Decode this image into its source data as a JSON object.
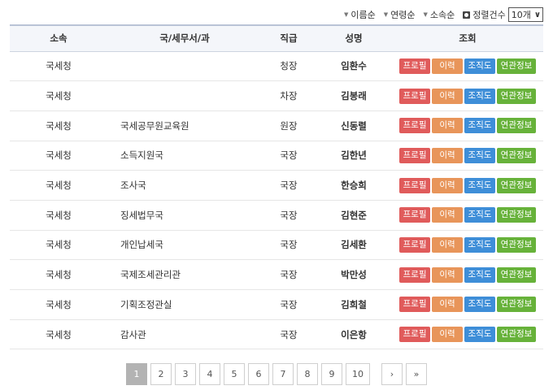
{
  "toolbar": {
    "sort_options": [
      {
        "label": "이름순"
      },
      {
        "label": "연령순"
      },
      {
        "label": "소속순"
      },
      {
        "label": "정렬건수"
      }
    ],
    "page_size": "10개"
  },
  "table": {
    "headers": [
      "소속",
      "국/세무서/과",
      "직급",
      "성명",
      "조회"
    ],
    "action_labels": {
      "profile": "프로필",
      "history": "이력",
      "org": "조직도",
      "related": "연관정보"
    },
    "rows": [
      {
        "org": "국세청",
        "dept": "",
        "rank": "청장",
        "name": "임환수"
      },
      {
        "org": "국세청",
        "dept": "",
        "rank": "차장",
        "name": "김봉래"
      },
      {
        "org": "국세청",
        "dept": "국세공무원교육원",
        "rank": "원장",
        "name": "신동렬"
      },
      {
        "org": "국세청",
        "dept": "소득지원국",
        "rank": "국장",
        "name": "김한년"
      },
      {
        "org": "국세청",
        "dept": "조사국",
        "rank": "국장",
        "name": "한승희"
      },
      {
        "org": "국세청",
        "dept": "징세법무국",
        "rank": "국장",
        "name": "김현준"
      },
      {
        "org": "국세청",
        "dept": "개인납세국",
        "rank": "국장",
        "name": "김세환"
      },
      {
        "org": "국세청",
        "dept": "국제조세관리관",
        "rank": "국장",
        "name": "박만성"
      },
      {
        "org": "국세청",
        "dept": "기획조정관실",
        "rank": "국장",
        "name": "김희철"
      },
      {
        "org": "국세청",
        "dept": "감사관",
        "rank": "국장",
        "name": "이은항"
      }
    ]
  },
  "pagination": {
    "pages": [
      "1",
      "2",
      "3",
      "4",
      "5",
      "6",
      "7",
      "8",
      "9",
      "10"
    ],
    "current": "1",
    "next": "›",
    "last": "»"
  }
}
